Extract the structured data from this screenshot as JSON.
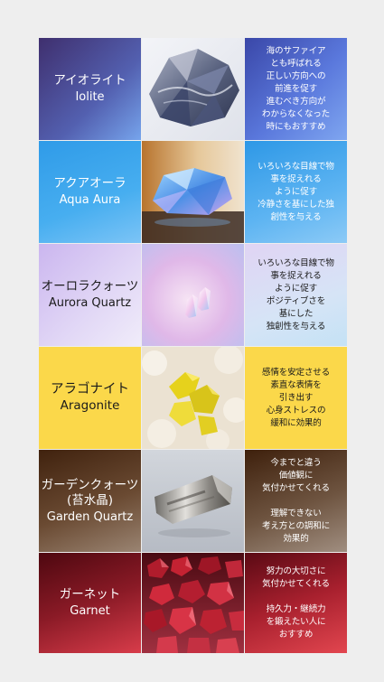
{
  "stones": [
    {
      "name_jp": "アイオライト",
      "name_en": "Iolite",
      "image": "iolite-photo",
      "description": [
        "海のサファイア",
        "とも呼ばれる",
        "正しい方向への",
        "前進を促す",
        "進むべき方向が",
        "わからなくなった",
        "時にもおすすめ"
      ]
    },
    {
      "name_jp": "アクアオーラ",
      "name_en": "Aqua Aura",
      "image": "aqua-aura-photo",
      "description": [
        "いろいろな目線で物",
        "事を捉えれる",
        "ように促す",
        "冷静さを基にした独",
        "創性を与える"
      ]
    },
    {
      "name_jp": "オーロラクォーツ",
      "name_en": "Aurora Quartz",
      "image": "aurora-quartz-photo",
      "description": [
        "いろいろな目線で物",
        "事を捉えれる",
        "ように促す",
        "ポジティブさを",
        "基にした",
        "独創性を与える"
      ]
    },
    {
      "name_jp": "アラゴナイト",
      "name_en": "Aragonite",
      "image": "aragonite-photo",
      "description": [
        "感情を安定させる",
        "素直な表情を",
        "引き出す",
        "心身ストレスの",
        "緩和に効果的"
      ]
    },
    {
      "name_jp": "ガーデンクォーツ",
      "name_jp2": "(苔水晶)",
      "name_en": "Garden Quartz",
      "image": "garden-quartz-photo",
      "description": [
        "今までと違う",
        "価値観に",
        "気付かせてくれる",
        "",
        "理解できない",
        "考え方との調和に",
        "効果的"
      ]
    },
    {
      "name_jp": "ガーネット",
      "name_en": "Garnet",
      "image": "garnet-photo",
      "description": [
        "努力の大切さに",
        "気付かせてくれる",
        "",
        "持久力・継続力",
        "を鍛えたい人に",
        "おすすめ"
      ]
    }
  ],
  "colors": {
    "background": "#eeeeee",
    "iolite": [
      "#4b3f80",
      "#6e8ee0"
    ],
    "aqua_aura": [
      "#3aa7ec",
      "#8cc8f4"
    ],
    "aurora_quartz": [
      "#d8c8f2",
      "#c6e3f5"
    ],
    "aragonite": "#fbd84a",
    "garden_quartz": [
      "#4a2a15",
      "#9a8472"
    ],
    "garnet": [
      "#5a0a14",
      "#e04250"
    ]
  }
}
